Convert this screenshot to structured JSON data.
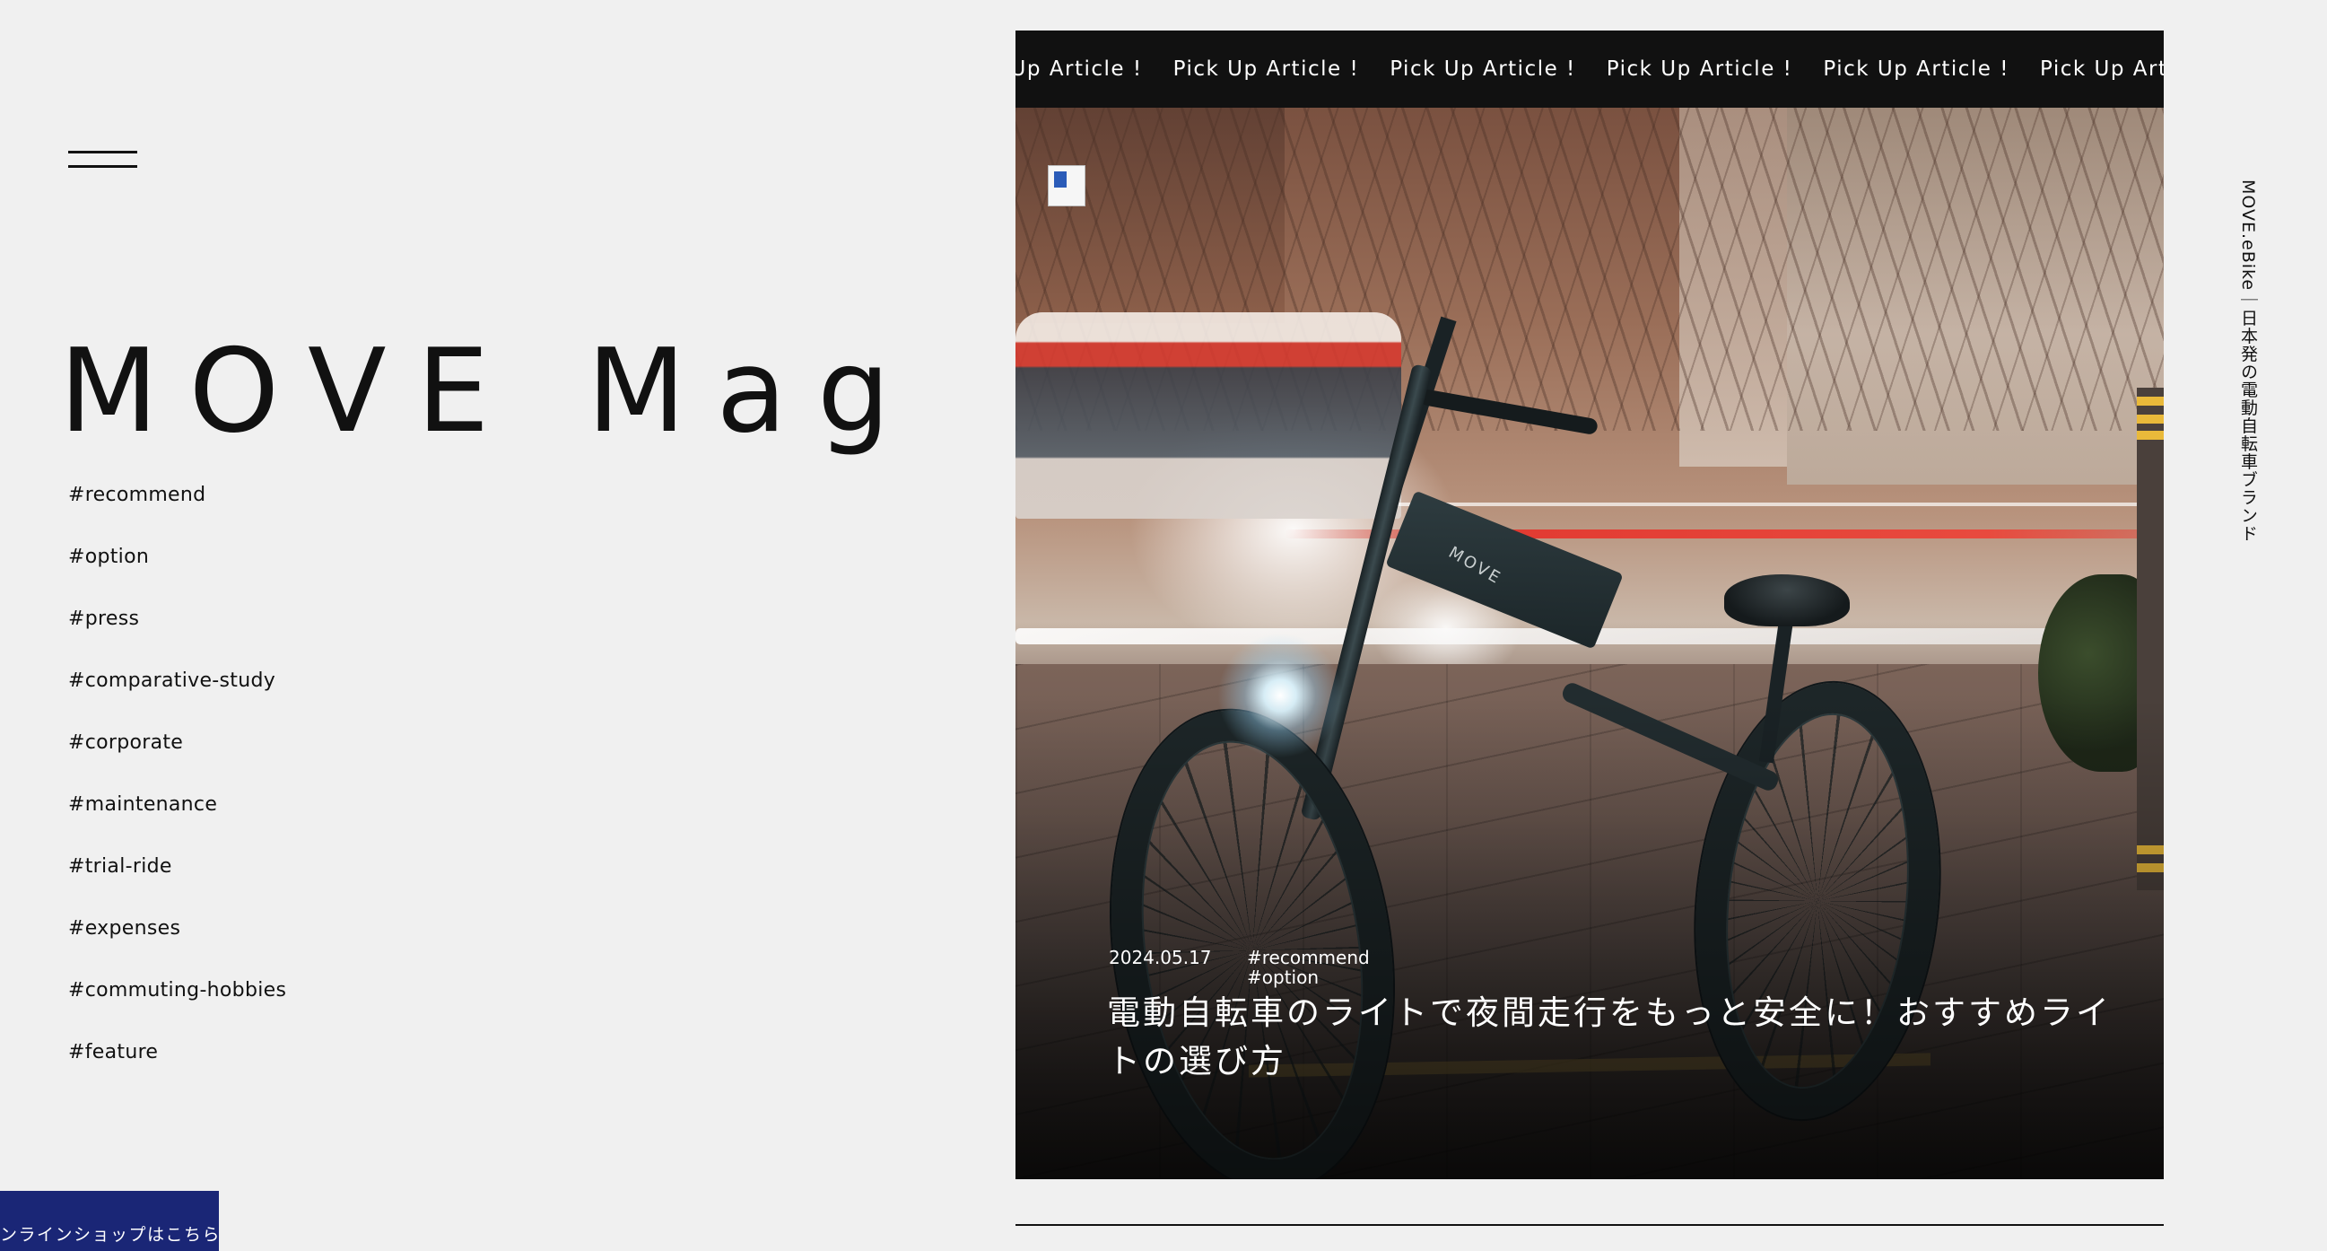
{
  "header": {
    "menu_icon": "hamburger-menu-icon",
    "site_title": "MOVE Mag"
  },
  "sidebar": {
    "tags": [
      {
        "label": "#recommend"
      },
      {
        "label": "#option"
      },
      {
        "label": "#press"
      },
      {
        "label": "#comparative-study"
      },
      {
        "label": "#corporate"
      },
      {
        "label": "#maintenance"
      },
      {
        "label": "#trial-ride"
      },
      {
        "label": "#expenses"
      },
      {
        "label": "#commuting-hobbies"
      },
      {
        "label": "#feature"
      }
    ],
    "shop_button_label": "オンラインショップはこちら"
  },
  "hero": {
    "ticker": [
      "Pick Up Article !",
      "Pick Up Article !",
      "Pick Up Article !",
      "Pick Up Article !",
      "Pick Up Article !",
      "Pick Up Article !",
      "Pick Up Article !"
    ],
    "image_alt": "MOVE e-bike parked on a city sidewalk at night with headlight on",
    "frame_brand": "MOVE",
    "article": {
      "date": "2024.05.17",
      "categories": [
        "#recommend",
        "#option"
      ],
      "title": "電動自転車のライトで夜間走行をもっと安全に！おすすめライトの選び方"
    }
  },
  "tagline": "MOVE.eBike｜日本発の電動自転車ブランド",
  "colors": {
    "background": "#f0f0f0",
    "text": "#111111",
    "ticker_bg": "#111111",
    "shop_button_bg": "#1a2676"
  }
}
